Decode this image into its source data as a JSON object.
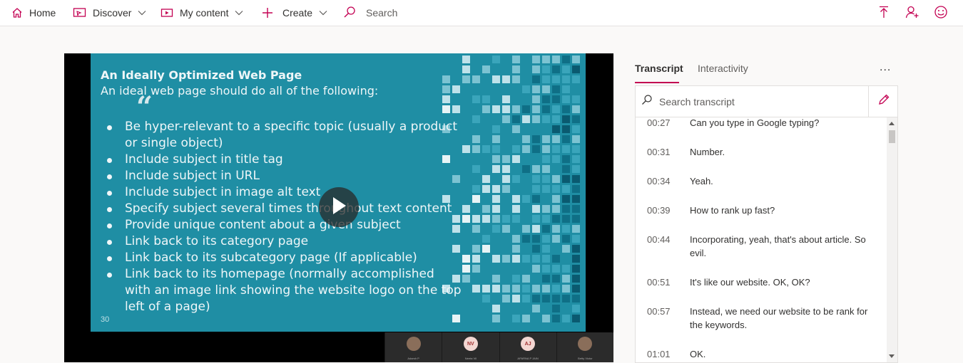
{
  "nav": {
    "home": "Home",
    "discover": "Discover",
    "my_content": "My content",
    "create": "Create",
    "search": "Search",
    "accent": "#c30052"
  },
  "video": {
    "slide_title": "An Ideally Optimized Web Page",
    "slide_subtitle": "An ideal web page should do all of the following:",
    "bullets": [
      "Be hyper-relevant to a specific topic (usually a product or single object)",
      "Include subject in title tag",
      "Include subject in URL",
      "Include subject in image alt text",
      "Specify subject several times throughout text content",
      "Provide unique content about a given subject",
      "Link back to its category page",
      "Link back to its subcategory page (If applicable)",
      "Link back to its homepage (normally accomplished with an image link showing the website logo on the top left of a page)"
    ],
    "page_number": "30",
    "participants": [
      {
        "initials": "",
        "name": "Adarsh P"
      },
      {
        "initials": "NV",
        "name": "Neeta Vil"
      },
      {
        "initials": "AJ",
        "name": "APARNA P JAIN"
      },
      {
        "initials": "",
        "name": "Betty Victor"
      }
    ]
  },
  "panel": {
    "tab_transcript": "Transcript",
    "tab_interactivity": "Interactivity",
    "more": "...",
    "search_placeholder": "Search transcript"
  },
  "transcript": [
    {
      "time": "00:27",
      "text": "Can you type in Google typing?"
    },
    {
      "time": "00:31",
      "text": "Number."
    },
    {
      "time": "00:34",
      "text": "Yeah."
    },
    {
      "time": "00:39",
      "text": "How to rank up fast?"
    },
    {
      "time": "00:44",
      "text": "Incorporating, yeah, that's about article. So evil."
    },
    {
      "time": "00:51",
      "text": "It's like our website. OK, OK?"
    },
    {
      "time": "00:57",
      "text": "Instead, we need our website to be rank for the keywords."
    },
    {
      "time": "01:01",
      "text": "OK."
    }
  ]
}
